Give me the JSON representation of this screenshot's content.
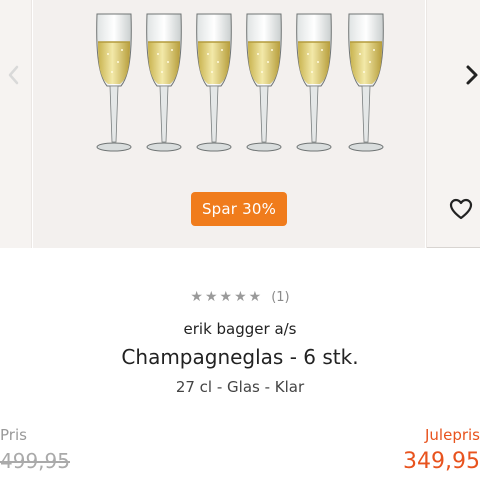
{
  "product": {
    "badge": "Spar 30%",
    "rating_count": "(1)",
    "rating_stars": 5,
    "brand": "erik bagger a/s",
    "title": "Champagneglas - 6 stk.",
    "subtitle": "27 cl - Glas - Klar"
  },
  "pricing": {
    "old_label": "Pris",
    "old_price": "499,95",
    "new_label": "Julepris",
    "new_price": "349,95"
  },
  "colors": {
    "accent": "#f07c1c",
    "price": "#e8531e"
  },
  "icons": {
    "prev": "chevron-left-icon",
    "next": "chevron-right-icon",
    "favorite": "heart-icon",
    "star": "star-icon"
  }
}
